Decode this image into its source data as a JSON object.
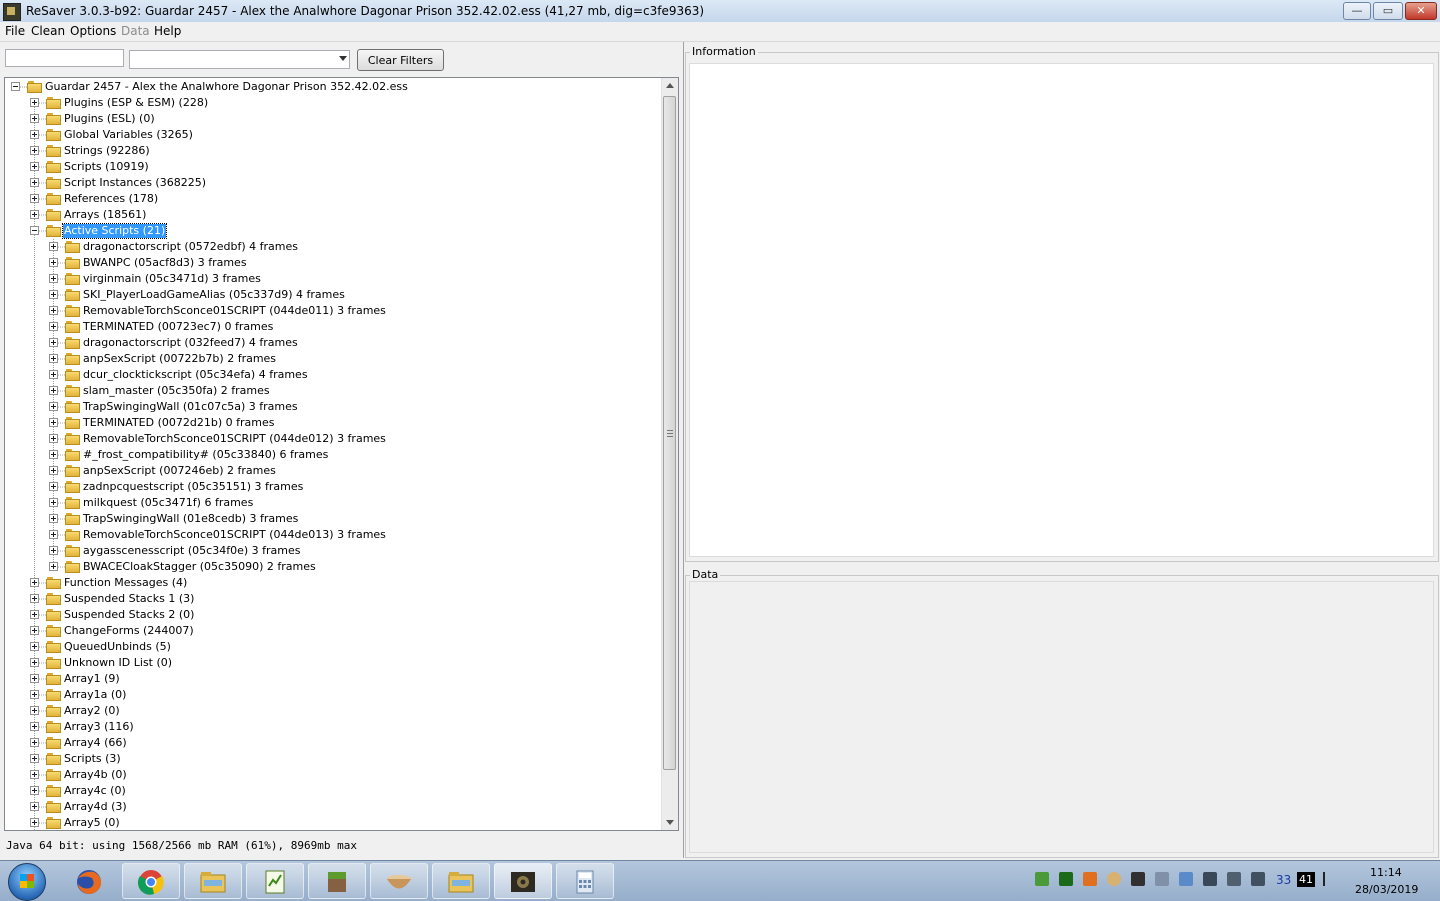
{
  "window": {
    "title": "ReSaver 3.0.3-b92: Guardar 2457 - Alex the Analwhore  Dagonar Prison  352.42.02.ess (41,27 mb, dig=c3fe9363)"
  },
  "window_controls": {
    "minimize": "—",
    "maximize": "▭",
    "close": "✕"
  },
  "menu": [
    "File",
    "Clean",
    "Options",
    "Data",
    "Help"
  ],
  "filter": {
    "text_value": "",
    "combo_value": "",
    "clear_label": "Clear Filters"
  },
  "tree": {
    "root": "Guardar 2457 - Alex the Analwhore  Dagonar Prison  352.42.02.ess",
    "groups": [
      "Plugins (ESP & ESM) (228)",
      "Plugins (ESL) (0)",
      "Global Variables (3265)",
      "Strings (92286)",
      "Scripts (10919)",
      "Script Instances (368225)",
      "References (178)",
      "Arrays (18561)",
      "Active Scripts (21)",
      "Function Messages (4)",
      "Suspended Stacks 1 (3)",
      "Suspended Stacks 2 (0)",
      "ChangeForms (244007)",
      "QueuedUnbinds (5)",
      "Unknown ID List (0)",
      "Array1 (9)",
      "Array1a (0)",
      "Array2 (0)",
      "Array3 (116)",
      "Array4 (66)",
      "Scripts (3)",
      "Array4b (0)",
      "Array4c (0)",
      "Array4d (3)",
      "Array5 (0)"
    ],
    "expanded_group": "Active Scripts (21)",
    "selected": "Active Scripts (21)",
    "active_scripts": [
      "dragonactorscript (0572edbf) 4 frames",
      "BWANPC (05acf8d3) 3 frames",
      "virginmain (05c3471d) 3 frames",
      "SKI_PlayerLoadGameAlias (05c337d9) 4 frames",
      "RemovableTorchSconce01SCRIPT (044de011) 3 frames",
      "TERMINATED (00723ec7) 0 frames",
      "dragonactorscript (032feed7) 4 frames",
      "anpSexScript (00722b7b) 2 frames",
      "dcur_clocktickscript (05c34efa) 4 frames",
      "slam_master (05c350fa) 2 frames",
      "TrapSwingingWall (01c07c5a) 3 frames",
      "TERMINATED (0072d21b) 0 frames",
      "RemovableTorchSconce01SCRIPT (044de012) 3 frames",
      "#_frost_compatibility# (05c33840) 6 frames",
      "anpSexScript (007246eb) 2 frames",
      "zadnpcquestscript (05c35151) 3 frames",
      "milkquest (05c3471f) 6 frames",
      "TrapSwingingWall (01e8cedb) 3 frames",
      "RemovableTorchSconce01SCRIPT (044de013) 3 frames",
      "aygasscenesscript (05c34f0e) 3 frames",
      "BWACECloakStagger (05c35090) 2 frames"
    ]
  },
  "status": "Java 64 bit: using 1568/2566 mb RAM (61%), 8969mb max",
  "panels": {
    "information": "Information",
    "data": "Data"
  },
  "taskbar": {
    "apps": [
      "firefox-icon",
      "chrome-icon",
      "explorer-icon",
      "notepad-icon",
      "minecraft-icon",
      "bowl-icon",
      "explorer-icon",
      "resaver-icon",
      "calculator-icon"
    ],
    "tray": {
      "badge_a": "33",
      "badge_b": "41"
    },
    "clock": {
      "time": "11:14",
      "date": "28/03/2019"
    }
  },
  "colors": {
    "selection": "#3399ff",
    "folder": "#f2c94c"
  }
}
